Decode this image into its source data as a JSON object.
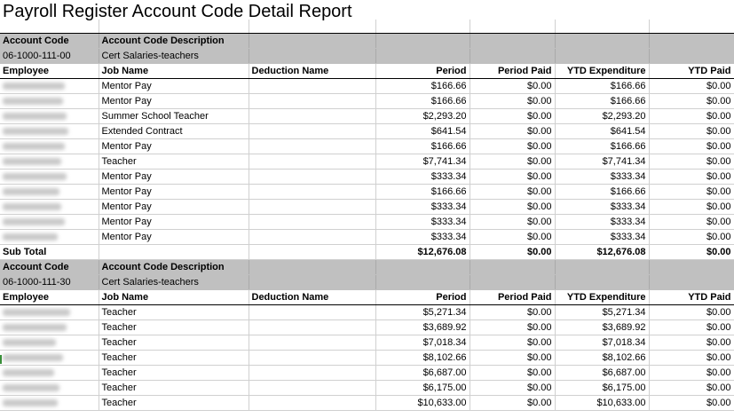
{
  "report_title": "Payroll Register Account Code Detail Report",
  "labels": {
    "account_code": "Account Code",
    "account_code_description": "Account Code Description",
    "employee": "Employee",
    "job_name": "Job Name",
    "deduction_name": "Deduction Name",
    "period": "Period",
    "period_paid": "Period Paid",
    "ytd_expenditure": "YTD Expenditure",
    "ytd_paid": "YTD Paid",
    "sub_total": "Sub Total"
  },
  "sections": [
    {
      "code": "06-1000-111-00",
      "description": "Cert Salaries-teachers",
      "rows": [
        {
          "job": "Mentor Pay",
          "period": "$166.66",
          "period_paid": "$0.00",
          "ytd_exp": "$166.66",
          "ytd_paid": "$0.00"
        },
        {
          "job": "Mentor Pay",
          "period": "$166.66",
          "period_paid": "$0.00",
          "ytd_exp": "$166.66",
          "ytd_paid": "$0.00"
        },
        {
          "job": "Summer School Teacher",
          "period": "$2,293.20",
          "period_paid": "$0.00",
          "ytd_exp": "$2,293.20",
          "ytd_paid": "$0.00"
        },
        {
          "job": "Extended Contract",
          "period": "$641.54",
          "period_paid": "$0.00",
          "ytd_exp": "$641.54",
          "ytd_paid": "$0.00"
        },
        {
          "job": "Mentor Pay",
          "period": "$166.66",
          "period_paid": "$0.00",
          "ytd_exp": "$166.66",
          "ytd_paid": "$0.00"
        },
        {
          "job": "Teacher",
          "period": "$7,741.34",
          "period_paid": "$0.00",
          "ytd_exp": "$7,741.34",
          "ytd_paid": "$0.00"
        },
        {
          "job": "Mentor Pay",
          "period": "$333.34",
          "period_paid": "$0.00",
          "ytd_exp": "$333.34",
          "ytd_paid": "$0.00"
        },
        {
          "job": "Mentor Pay",
          "period": "$166.66",
          "period_paid": "$0.00",
          "ytd_exp": "$166.66",
          "ytd_paid": "$0.00"
        },
        {
          "job": "Mentor Pay",
          "period": "$333.34",
          "period_paid": "$0.00",
          "ytd_exp": "$333.34",
          "ytd_paid": "$0.00"
        },
        {
          "job": "Mentor Pay",
          "period": "$333.34",
          "period_paid": "$0.00",
          "ytd_exp": "$333.34",
          "ytd_paid": "$0.00"
        },
        {
          "job": "Mentor Pay",
          "period": "$333.34",
          "period_paid": "$0.00",
          "ytd_exp": "$333.34",
          "ytd_paid": "$0.00"
        }
      ],
      "subtotal": {
        "period": "$12,676.08",
        "period_paid": "$0.00",
        "ytd_exp": "$12,676.08",
        "ytd_paid": "$0.00"
      }
    },
    {
      "code": "06-1000-111-30",
      "description": "Cert Salaries-teachers",
      "rows": [
        {
          "job": "Teacher",
          "period": "$5,271.34",
          "period_paid": "$0.00",
          "ytd_exp": "$5,271.34",
          "ytd_paid": "$0.00"
        },
        {
          "job": "Teacher",
          "period": "$3,689.92",
          "period_paid": "$0.00",
          "ytd_exp": "$3,689.92",
          "ytd_paid": "$0.00"
        },
        {
          "job": "Teacher",
          "period": "$7,018.34",
          "period_paid": "$0.00",
          "ytd_exp": "$7,018.34",
          "ytd_paid": "$0.00"
        },
        {
          "job": "Teacher",
          "period": "$8,102.66",
          "period_paid": "$0.00",
          "ytd_exp": "$8,102.66",
          "ytd_paid": "$0.00"
        },
        {
          "job": "Teacher",
          "period": "$6,687.00",
          "period_paid": "$0.00",
          "ytd_exp": "$6,687.00",
          "ytd_paid": "$0.00"
        },
        {
          "job": "Teacher",
          "period": "$6,175.00",
          "period_paid": "$0.00",
          "ytd_exp": "$6,175.00",
          "ytd_paid": "$0.00"
        },
        {
          "job": "Teacher",
          "period": "$10,633.00",
          "period_paid": "$0.00",
          "ytd_exp": "$10,633.00",
          "ytd_paid": "$0.00"
        }
      ]
    }
  ]
}
